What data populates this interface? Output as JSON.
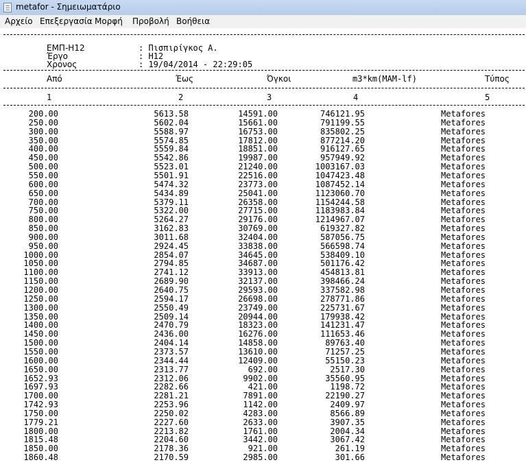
{
  "window": {
    "title": "metafor - Σημειωματάριο"
  },
  "menu": [
    "Αρχείο",
    "Επεξεργασία",
    "Μορφή",
    "Προβολή",
    "Βοήθεια"
  ],
  "header": {
    "lines": [
      {
        "key": "ΕΜΠ-Η12",
        "value": ": Πισπιρίγκος Α."
      },
      {
        "key": "Έργο",
        "value": ": Η12"
      },
      {
        "key": "Χρονος",
        "value": ": 19/04/2014 - 22:29:05"
      }
    ]
  },
  "columns": {
    "headers": [
      "Από",
      "Έως",
      "Όγκοι",
      "m3*km(MAM-lf)",
      "Τύπος"
    ],
    "numbers": [
      "1",
      "2",
      "3",
      "4",
      "5"
    ]
  },
  "rows": [
    [
      "200.00",
      "5613.58",
      "14591.00",
      "746121.95",
      "Metafores"
    ],
    [
      "250.00",
      "5602.04",
      "15661.00",
      "791199.55",
      "Metafores"
    ],
    [
      "300.00",
      "5588.97",
      "16753.00",
      "835802.25",
      "Metafores"
    ],
    [
      "350.00",
      "5574.85",
      "17812.00",
      "877214.20",
      "Metafores"
    ],
    [
      "400.00",
      "5559.84",
      "18851.00",
      "916127.65",
      "Metafores"
    ],
    [
      "450.00",
      "5542.86",
      "19987.00",
      "957949.92",
      "Metafores"
    ],
    [
      "500.00",
      "5523.01",
      "21240.00",
      "1003167.03",
      "Metafores"
    ],
    [
      "550.00",
      "5501.91",
      "22516.00",
      "1047423.48",
      "Metafores"
    ],
    [
      "600.00",
      "5474.32",
      "23773.00",
      "1087452.14",
      "Metafores"
    ],
    [
      "650.00",
      "5434.89",
      "25041.00",
      "1123060.70",
      "Metafores"
    ],
    [
      "700.00",
      "5379.11",
      "26358.00",
      "1154244.58",
      "Metafores"
    ],
    [
      "750.00",
      "5322.00",
      "27715.00",
      "1183983.84",
      "Metafores"
    ],
    [
      "800.00",
      "5264.27",
      "29176.00",
      "1214967.07",
      "Metafores"
    ],
    [
      "850.00",
      "3162.83",
      "30769.00",
      "619327.82",
      "Metafores"
    ],
    [
      "900.00",
      "3011.68",
      "32404.00",
      "587056.75",
      "Metafores"
    ],
    [
      "950.00",
      "2924.45",
      "33838.00",
      "566598.74",
      "Metafores"
    ],
    [
      "1000.00",
      "2854.07",
      "34645.00",
      "538409.10",
      "Metafores"
    ],
    [
      "1050.00",
      "2794.85",
      "34687.00",
      "501176.42",
      "Metafores"
    ],
    [
      "1100.00",
      "2741.12",
      "33913.00",
      "454813.81",
      "Metafores"
    ],
    [
      "1150.00",
      "2689.90",
      "32137.00",
      "398466.24",
      "Metafores"
    ],
    [
      "1200.00",
      "2640.75",
      "29593.00",
      "337582.98",
      "Metafores"
    ],
    [
      "1250.00",
      "2594.17",
      "26698.00",
      "278771.86",
      "Metafores"
    ],
    [
      "1300.00",
      "2550.49",
      "23749.00",
      "225731.67",
      "Metafores"
    ],
    [
      "1350.00",
      "2509.14",
      "20944.00",
      "179938.42",
      "Metafores"
    ],
    [
      "1400.00",
      "2470.79",
      "18323.00",
      "141231.47",
      "Metafores"
    ],
    [
      "1450.00",
      "2436.00",
      "16276.00",
      "111653.46",
      "Metafores"
    ],
    [
      "1500.00",
      "2404.14",
      "14858.00",
      "89763.40",
      "Metafores"
    ],
    [
      "1550.00",
      "2373.57",
      "13610.00",
      "71257.25",
      "Metafores"
    ],
    [
      "1600.00",
      "2344.44",
      "12409.00",
      "55150.23",
      "Metafores"
    ],
    [
      "1650.00",
      "2313.77",
      "692.00",
      "2517.30",
      "Metafores"
    ],
    [
      "1652.93",
      "2312.06",
      "9902.00",
      "35560.95",
      "Metafores"
    ],
    [
      "1697.93",
      "2282.66",
      "421.00",
      "1198.72",
      "Metafores"
    ],
    [
      "1700.00",
      "2281.21",
      "7891.00",
      "22190.27",
      "Metafores"
    ],
    [
      "1742.93",
      "2253.96",
      "1142.00",
      "2409.97",
      "Metafores"
    ],
    [
      "1750.00",
      "2250.02",
      "4283.00",
      "8566.89",
      "Metafores"
    ],
    [
      "1779.21",
      "2227.60",
      "2633.00",
      "3907.35",
      "Metafores"
    ],
    [
      "1800.00",
      "2213.82",
      "1761.00",
      "2004.34",
      "Metafores"
    ],
    [
      "1815.48",
      "2204.60",
      "3442.00",
      "3067.42",
      "Metafores"
    ],
    [
      "1850.00",
      "2178.36",
      "921.00",
      "261.19",
      "Metafores"
    ],
    [
      "1860.48",
      "2170.59",
      "2985.00",
      "301.66",
      "Metafores"
    ]
  ]
}
